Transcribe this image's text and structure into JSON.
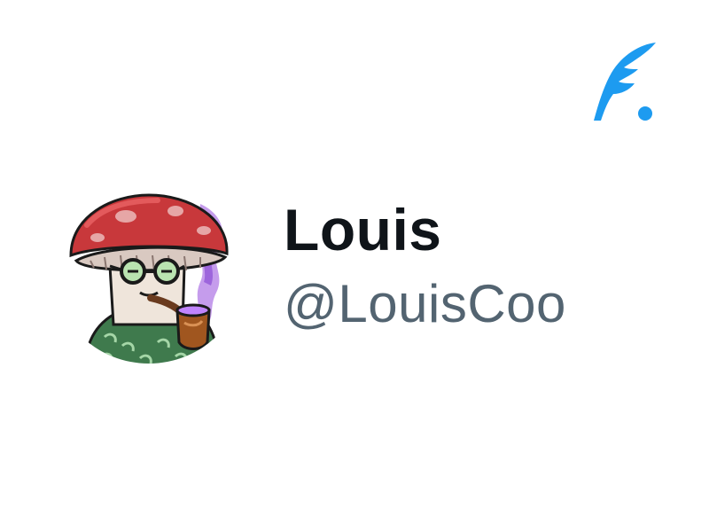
{
  "app": {
    "logo_icon": "quill-feather-icon",
    "accent_color": "#1d9bf0"
  },
  "profile": {
    "avatar_icon": "mushroom-character-avatar",
    "display_name": "Louis",
    "handle": "@LouisCoo"
  },
  "colors": {
    "name_text": "#0f1419",
    "handle_text": "#536471",
    "background": "#ffffff"
  }
}
